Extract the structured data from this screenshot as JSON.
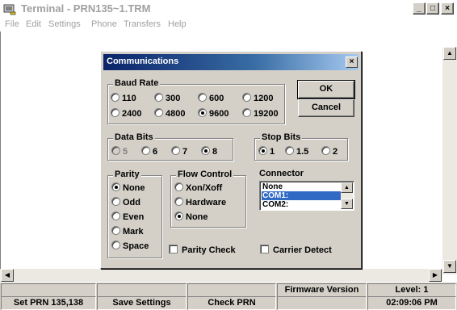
{
  "window": {
    "title": "Terminal - PRN135~1.TRM",
    "minimize_glyph": "_",
    "maximize_glyph": "□",
    "close_glyph": "×"
  },
  "menu": [
    "File",
    "Edit",
    "Settings",
    "Phone",
    "Transfers",
    "Help"
  ],
  "dialog": {
    "title": "Communications",
    "close_glyph": "×",
    "ok_label": "OK",
    "cancel_label": "Cancel",
    "baud_rate": {
      "label": "Baud Rate",
      "options": [
        "110",
        "300",
        "600",
        "1200",
        "2400",
        "4800",
        "9600",
        "19200"
      ],
      "selected": "9600"
    },
    "data_bits": {
      "label": "Data Bits",
      "options": [
        "5",
        "6",
        "7",
        "8"
      ],
      "disabled": [
        "5"
      ],
      "selected": "8"
    },
    "stop_bits": {
      "label": "Stop Bits",
      "options": [
        "1",
        "1.5",
        "2"
      ],
      "selected": "1"
    },
    "parity": {
      "label": "Parity",
      "options": [
        "None",
        "Odd",
        "Even",
        "Mark",
        "Space"
      ],
      "selected": "None"
    },
    "flow_control": {
      "label": "Flow Control",
      "options": [
        "Xon/Xoff",
        "Hardware",
        "None"
      ],
      "selected": "None"
    },
    "connector": {
      "label": "Connector",
      "items": [
        "None",
        "COM1:",
        "COM2:"
      ],
      "selected": "COM1:"
    },
    "parity_check_label": "Parity Check",
    "parity_check_checked": false,
    "carrier_detect_label": "Carrier Detect",
    "carrier_detect_checked": false
  },
  "status_bar": {
    "row1": [
      "",
      "",
      "",
      "Firmware Version",
      "Level: 1"
    ],
    "row2": [
      "Set PRN 135,138",
      "Save Settings",
      "Check PRN",
      "",
      "02:09:06 PM"
    ]
  },
  "icons": {
    "app": "terminal-phone-icon",
    "scroll_up": "scroll-up-arrow-icon",
    "scroll_down": "scroll-down-arrow-icon",
    "scroll_left": "scroll-left-arrow-icon",
    "scroll_right": "scroll-right-arrow-icon"
  },
  "colors": {
    "dialog_title_start": "#0a246a",
    "dialog_title_end": "#a6caf0",
    "selection": "#316ac5",
    "face": "#d4d0c8"
  }
}
